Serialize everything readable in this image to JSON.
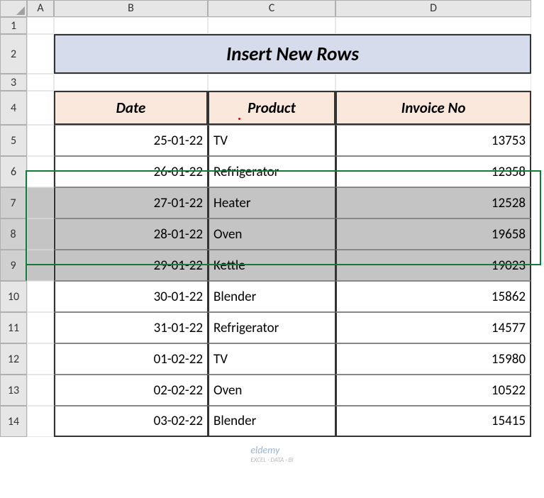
{
  "columns": [
    "A",
    "B",
    "C",
    "D"
  ],
  "rows": [
    "1",
    "2",
    "3",
    "4",
    "5",
    "6",
    "7",
    "8",
    "9",
    "10",
    "11",
    "12",
    "13",
    "14"
  ],
  "title": "Insert New Rows",
  "headers": {
    "date": "Date",
    "product": "Product",
    "invoice": "Invoice No"
  },
  "chart_data": {
    "type": "table",
    "title": "Insert New Rows",
    "columns": [
      "Date",
      "Product",
      "Invoice No"
    ],
    "rows": [
      {
        "date": "25-01-22",
        "product": "TV",
        "invoice": 13753
      },
      {
        "date": "26-01-22",
        "product": "Refrigerator",
        "invoice": 12358
      },
      {
        "date": "27-01-22",
        "product": "Heater",
        "invoice": 12528
      },
      {
        "date": "28-01-22",
        "product": "Oven",
        "invoice": 19658
      },
      {
        "date": "29-01-22",
        "product": "Kettle",
        "invoice": 19023
      },
      {
        "date": "30-01-22",
        "product": "Blender",
        "invoice": 15862
      },
      {
        "date": "31-01-22",
        "product": "Refrigerator",
        "invoice": 14577
      },
      {
        "date": "01-02-22",
        "product": "TV",
        "invoice": 15980
      },
      {
        "date": "02-02-22",
        "product": "Oven",
        "invoice": 10522
      },
      {
        "date": "03-02-22",
        "product": "Blender",
        "invoice": 15415
      }
    ],
    "selected_row_indices": [
      2,
      3,
      4
    ]
  },
  "watermark": {
    "main": "eldemy",
    "sub": "EXCEL · DATA · BI"
  }
}
